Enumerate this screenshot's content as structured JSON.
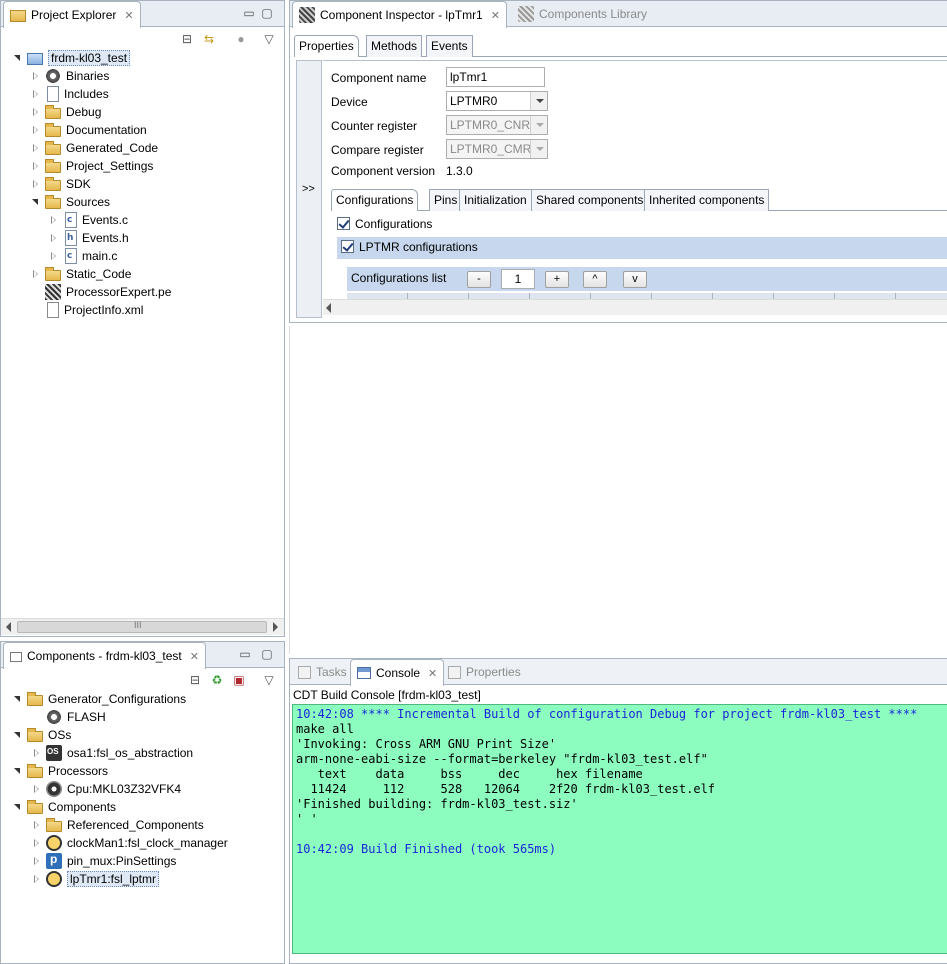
{
  "project_explorer": {
    "tab_label": "Project Explorer",
    "tree": [
      {
        "label": "frdm-kl03_test",
        "icon": "project-icon",
        "depth": 0,
        "state": "open",
        "selected": true
      },
      {
        "label": "Binaries",
        "icon": "binaries-icon",
        "depth": 1,
        "state": "closed"
      },
      {
        "label": "Includes",
        "icon": "includes-icon",
        "depth": 1,
        "state": "closed"
      },
      {
        "label": "Debug",
        "icon": "folder-icon",
        "depth": 1,
        "state": "closed"
      },
      {
        "label": "Documentation",
        "icon": "folder-icon",
        "depth": 1,
        "state": "closed"
      },
      {
        "label": "Generated_Code",
        "icon": "folder-icon",
        "depth": 1,
        "state": "closed"
      },
      {
        "label": "Project_Settings",
        "icon": "folder-icon",
        "depth": 1,
        "state": "closed"
      },
      {
        "label": "SDK",
        "icon": "folder-icon",
        "depth": 1,
        "state": "closed"
      },
      {
        "label": "Sources",
        "icon": "folder-icon",
        "depth": 1,
        "state": "open"
      },
      {
        "label": "Events.c",
        "icon": "c-file-icon",
        "depth": 2,
        "state": "closed"
      },
      {
        "label": "Events.h",
        "icon": "h-file-icon",
        "depth": 2,
        "state": "closed"
      },
      {
        "label": "main.c",
        "icon": "c-file-icon",
        "depth": 2,
        "state": "closed"
      },
      {
        "label": "Static_Code",
        "icon": "folder-icon",
        "depth": 1,
        "state": "closed"
      },
      {
        "label": "ProcessorExpert.pe",
        "icon": "pe-file-icon",
        "depth": 1,
        "state": "none"
      },
      {
        "label": "ProjectInfo.xml",
        "icon": "xml-file-icon",
        "depth": 1,
        "state": "none"
      }
    ],
    "scroll_label": "III"
  },
  "components": {
    "tab_label": "Components - frdm-kl03_test",
    "tree": [
      {
        "label": "Generator_Configurations",
        "icon": "folder-icon",
        "depth": 0,
        "state": "open"
      },
      {
        "label": "FLASH",
        "icon": "gear-icon",
        "depth": 1,
        "state": "none"
      },
      {
        "label": "OSs",
        "icon": "folder-icon",
        "depth": 0,
        "state": "open"
      },
      {
        "label": "osa1:fsl_os_abstraction",
        "icon": "os-chip-icon",
        "depth": 1,
        "state": "closed"
      },
      {
        "label": "Processors",
        "icon": "folder-icon",
        "depth": 0,
        "state": "open"
      },
      {
        "label": "Cpu:MKL03Z32VFK4",
        "icon": "cpu-icon",
        "depth": 1,
        "state": "closed"
      },
      {
        "label": "Components",
        "icon": "folder-icon",
        "depth": 0,
        "state": "open"
      },
      {
        "label": "Referenced_Components",
        "icon": "folder-icon",
        "depth": 1,
        "state": "closed"
      },
      {
        "label": "clockMan1:fsl_clock_manager",
        "icon": "clock-icon",
        "depth": 1,
        "state": "closed"
      },
      {
        "label": "pin_mux:PinSettings",
        "icon": "pin-icon",
        "depth": 1,
        "state": "closed"
      },
      {
        "label": "lpTmr1:fsl_lptmr",
        "icon": "timer-icon",
        "depth": 1,
        "state": "closed",
        "selected": true
      }
    ]
  },
  "inspector": {
    "tab_label": "Component Inspector - lpTmr1",
    "library_tab_label": "Components Library",
    "subtabs": [
      "Properties",
      "Methods",
      "Events"
    ],
    "expand_label": ">>",
    "rows": [
      {
        "label": "Component name",
        "value": "lpTmr1",
        "kind": "text"
      },
      {
        "label": "Device",
        "value": "LPTMR0",
        "kind": "select"
      },
      {
        "label": "Counter register",
        "value": "LPTMR0_CNR",
        "kind": "select-disabled"
      },
      {
        "label": "Compare register",
        "value": "LPTMR0_CMR",
        "kind": "select-disabled"
      },
      {
        "label": "Component version",
        "value": "1.3.0",
        "kind": "static"
      }
    ],
    "config_tabs": [
      "Configurations",
      "Pins",
      "Initialization",
      "Shared components",
      "Inherited components"
    ],
    "configurations_check": "Configurations",
    "lptmr_check": "LPTMR configurations",
    "list_label": "Configurations list",
    "list_count": "1",
    "btn_minus": "-",
    "btn_plus": "+",
    "btn_up": "^",
    "btn_down": "v"
  },
  "bottom": {
    "tabs": [
      "Tasks",
      "Console",
      "Properties"
    ],
    "console_title": "CDT Build Console [frdm-kl03_test]",
    "console_lines": [
      {
        "text": "10:42:08 **** Incremental Build of configuration Debug for project frdm-kl03_test ****",
        "color": "blue"
      },
      {
        "text": "make all",
        "color": "black"
      },
      {
        "text": "'Invoking: Cross ARM GNU Print Size'",
        "color": "black"
      },
      {
        "text": "arm-none-eabi-size --format=berkeley \"frdm-kl03_test.elf\"",
        "color": "black"
      },
      {
        "text": "   text    data     bss     dec     hex filename",
        "color": "black"
      },
      {
        "text": "  11424     112     528   12064    2f20 frdm-kl03_test.elf",
        "color": "black"
      },
      {
        "text": "'Finished building: frdm-kl03_test.siz'",
        "color": "black"
      },
      {
        "text": "' '",
        "color": "black"
      },
      {
        "text": "",
        "color": "black"
      },
      {
        "text": "10:42:09 Build Finished (took 565ms)",
        "color": "blue"
      }
    ]
  },
  "colors": {
    "console_bg": "#8cfdbf",
    "console_blue": "#1a26d8",
    "selection": "#dfe9f6",
    "config_header": "#c7d8ee"
  }
}
